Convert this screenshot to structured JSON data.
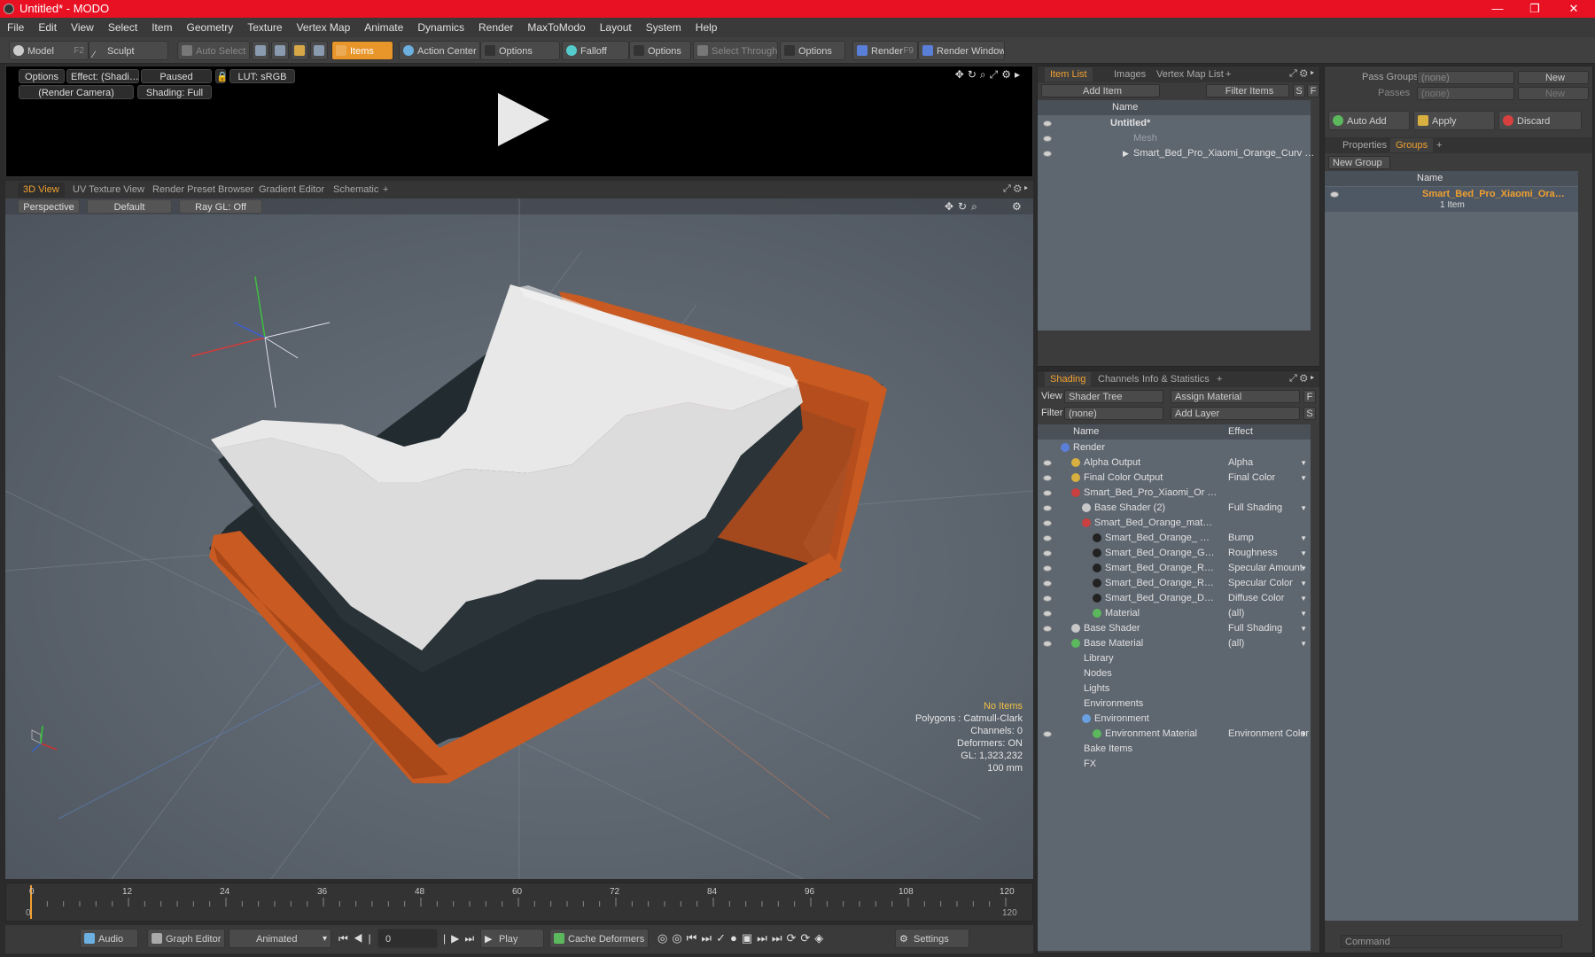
{
  "app": {
    "title": "Untitled* - MODO"
  },
  "menu": [
    "File",
    "Edit",
    "View",
    "Select",
    "Item",
    "Geometry",
    "Texture",
    "Vertex Map",
    "Animate",
    "Dynamics",
    "Render",
    "MaxToModo",
    "Layout",
    "System",
    "Help"
  ],
  "toolbar": {
    "model": "Model",
    "model_key": "F2",
    "sculpt": "Sculpt",
    "auto_select": "Auto Select",
    "items": "Items",
    "action_center": "Action Center",
    "options1": "Options",
    "falloff": "Falloff",
    "options2": "Options",
    "select_through": "Select Through",
    "options3": "Options",
    "render": "Render",
    "render_key": "F9",
    "render_window": "Render Window"
  },
  "render_panel": {
    "options": "Options",
    "effect": "Effect: (Shadi…",
    "paused": "Paused",
    "lut": "LUT: sRGB",
    "camera": "(Render Camera)",
    "shading": "Shading: Full"
  },
  "viewport_tabs": [
    "3D View",
    "UV Texture View",
    "Render Preset Browser",
    "Gradient Editor",
    "Schematic",
    "+"
  ],
  "viewport": {
    "perspective": "Perspective",
    "default": "Default",
    "raygl": "Ray GL: Off",
    "hud": [
      "No Items",
      "Polygons : Catmull-Clark",
      "Channels: 0",
      "Deformers: ON",
      "GL: 1,323,232",
      "100 mm"
    ],
    "axis_x": "X",
    "axis_y": "Y",
    "axis_z": "Z"
  },
  "timeline": {
    "ticks": [
      "0",
      "12",
      "24",
      "36",
      "48",
      "60",
      "72",
      "84",
      "96",
      "108",
      "120"
    ],
    "start": "0",
    "end": "120"
  },
  "transport": {
    "audio": "Audio",
    "graph_editor": "Graph Editor",
    "animated": "Animated",
    "frame": "0",
    "play": "Play",
    "cache_deformers": "Cache Deformers",
    "settings": "Settings"
  },
  "item_list": {
    "tabs": [
      "Item List",
      "Images",
      "Vertex Map List",
      "+"
    ],
    "add_item": "Add Item",
    "filter_items": "Filter Items",
    "s": "S",
    "f": "F",
    "col_name": "Name",
    "rows": [
      {
        "label": "Untitled*",
        "indent": 0
      },
      {
        "label": "Mesh",
        "indent": 1
      },
      {
        "label": "Smart_Bed_Pro_Xiaomi_Orange_Curv …",
        "indent": 1
      }
    ]
  },
  "shading": {
    "tabs": [
      "Shading",
      "Channels",
      "Info & Statistics",
      "+"
    ],
    "view_label": "View",
    "view_value": "Shader Tree",
    "assign_material": "Assign Material",
    "filter_label": "Filter",
    "filter_value": "(none)",
    "add_layer": "Add Layer",
    "f": "F",
    "s": "S",
    "col_name": "Name",
    "col_effect": "Effect",
    "rows": [
      {
        "label": "Render",
        "effect": "",
        "indent": 0,
        "color": "#5a7fd8"
      },
      {
        "label": "Alpha Output",
        "effect": "Alpha",
        "indent": 1,
        "color": "#d8b040"
      },
      {
        "label": "Final Color Output",
        "effect": "Final Color",
        "indent": 1,
        "color": "#d8b040"
      },
      {
        "label": "Smart_Bed_Pro_Xiaomi_Or …",
        "effect": "",
        "indent": 1,
        "color": "#c84040"
      },
      {
        "label": "Base Shader (2)",
        "effect": "Full Shading",
        "indent": 2,
        "color": "#c8c8c8"
      },
      {
        "label": "Smart_Bed_Orange_mat…",
        "effect": "",
        "indent": 2,
        "color": "#c84040"
      },
      {
        "label": "Smart_Bed_Orange_ …",
        "effect": "Bump",
        "indent": 3,
        "color": "#222"
      },
      {
        "label": "Smart_Bed_Orange_G…",
        "effect": "Roughness",
        "indent": 3,
        "color": "#222"
      },
      {
        "label": "Smart_Bed_Orange_R…",
        "effect": "Specular Amount",
        "indent": 3,
        "color": "#222"
      },
      {
        "label": "Smart_Bed_Orange_R…",
        "effect": "Specular Color",
        "indent": 3,
        "color": "#222"
      },
      {
        "label": "Smart_Bed_Orange_D…",
        "effect": "Diffuse Color",
        "indent": 3,
        "color": "#222"
      },
      {
        "label": "Material",
        "effect": "(all)",
        "indent": 3,
        "color": "#5cb85c"
      },
      {
        "label": "Base Shader",
        "effect": "Full Shading",
        "indent": 1,
        "color": "#c8c8c8"
      },
      {
        "label": "Base Material",
        "effect": "(all)",
        "indent": 1,
        "color": "#5cb85c"
      },
      {
        "label": "Library",
        "effect": "",
        "indent": 1,
        "color": ""
      },
      {
        "label": "Nodes",
        "effect": "",
        "indent": 1,
        "color": ""
      },
      {
        "label": "Lights",
        "effect": "",
        "indent": 1,
        "color": ""
      },
      {
        "label": "Environments",
        "effect": "",
        "indent": 1,
        "color": ""
      },
      {
        "label": "Environment",
        "effect": "",
        "indent": 2,
        "color": "#6aa0e0"
      },
      {
        "label": "Environment Material",
        "effect": "Environment Color",
        "indent": 3,
        "color": "#5cb85c"
      },
      {
        "label": "Bake Items",
        "effect": "",
        "indent": 1,
        "color": ""
      },
      {
        "label": "FX",
        "effect": "",
        "indent": 1,
        "color": ""
      }
    ]
  },
  "groups": {
    "pass_groups": "Pass Groups",
    "pass_groups_value": "(none)",
    "passes": "Passes",
    "passes_value": "(none)",
    "new1": "New",
    "new2": "New",
    "auto_add": "Auto Add",
    "apply": "Apply",
    "discard": "Discard",
    "tabs": [
      "Properties",
      "Groups",
      "+"
    ],
    "new_group": "New Group",
    "col_name": "Name",
    "item_name": "Smart_Bed_Pro_Xiaomi_Ora…",
    "item_count": "1 Item",
    "command": "Command"
  },
  "colors": {
    "accent": "#f0a030",
    "titlebar": "#e81123",
    "bed_frame": "#c8581e"
  }
}
